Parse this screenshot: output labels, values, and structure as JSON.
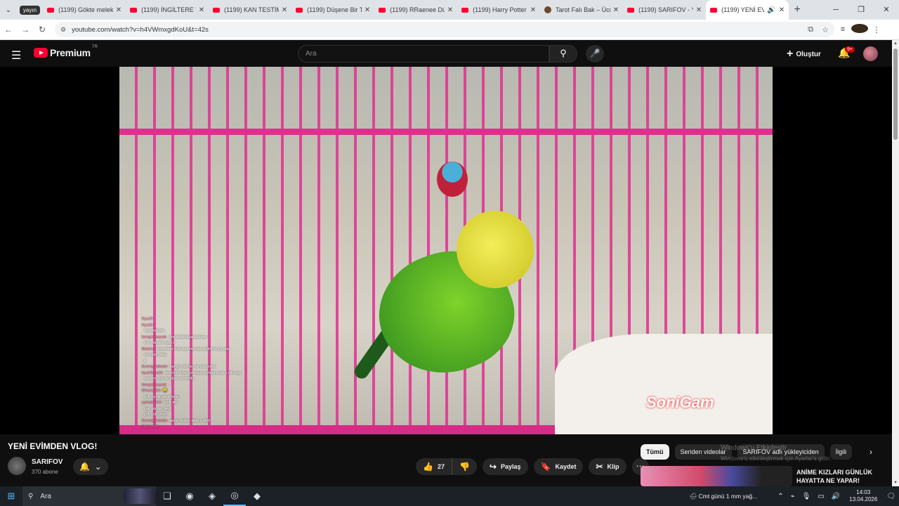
{
  "browser": {
    "group_label": "yayın",
    "tabs": [
      {
        "title": "(1199) Gökte melek",
        "favicon": "youtube-icon"
      },
      {
        "title": "(1199) İNGİLTERE VL",
        "favicon": "youtube-icon"
      },
      {
        "title": "(1199) KAN TESTİM",
        "favicon": "youtube-icon"
      },
      {
        "title": "(1199) Düşene Bir Te",
        "favicon": "youtube-icon"
      },
      {
        "title": "(1199) RRaenee Düş",
        "favicon": "youtube-icon"
      },
      {
        "title": "(1199) Harry Potter",
        "favicon": "youtube-icon"
      },
      {
        "title": "Tarot Falı Bak – Ücre",
        "favicon": "tarot-icon"
      },
      {
        "title": "(1199) SARIFOV - Yo",
        "favicon": "youtube-icon"
      },
      {
        "title": "(1199) YENİ EVİ",
        "favicon": "youtube-icon",
        "active": true
      }
    ],
    "url": "youtube.com/watch?v=h4VWmxgdKoU&t=42s"
  },
  "youtube": {
    "logo_text": "Premium",
    "region": "TR",
    "search_placeholder": "Ara",
    "create_label": "Oluştur",
    "notification_count": "9+"
  },
  "video": {
    "watermark": "SoniGam",
    "chat": [
      {
        "user": "Kyu10",
        "msg": ""
      },
      {
        "user": "Kyu10",
        "msg": ""
      },
      {
        "user": "",
        "msg": "hifjsdmfsdm"
      },
      {
        "user": "bengünbayrak",
        "msg": "sksdaldskdlsalkdalasd"
      },
      {
        "user": "",
        "msg": "tek yalçakli ugey.ir"
      },
      {
        "user": "Batuhx",
        "msg": "abonelere özel ses mesajı açilim fin ya abe"
      },
      {
        "user": "",
        "msg": "mesajım ekle"
      },
      {
        "user": "",
        "msg": "k"
      },
      {
        "user": "Ecemgunkeder",
        "msg": "bengin abi bu ne yakışıklık"
      },
      {
        "user": "kyu10kyu10",
        "msg": "abi rn50 fotsi için bazı sözlerim var x ollo cup"
      },
      {
        "user": "",
        "msg": "yazdım yok ve diyor ne mutlu"
      },
      {
        "user": "bengünbayrak",
        "msg": ":*"
      },
      {
        "user": "Ehsunjalim",
        "msg": "😄"
      },
      {
        "user": "",
        "msg": "yok ya ya gece falan"
      },
      {
        "user": "yamahar13",
        "msg": "iyidir abi"
      },
      {
        "user": "",
        "msg": "çok sia mu degil"
      },
      {
        "user": "",
        "msg": "yok çok iyisin"
      },
      {
        "user": "Ecemgunkeder",
        "msg": "anne cemre abla o bildi"
      },
      {
        "user": "NoXomuk",
        "msg": ""
      }
    ]
  },
  "watch": {
    "title": "YENİ EVİMDEN VLOG!",
    "channel": "SARIFOV",
    "subscribers": "370 abone",
    "likes": "27",
    "share_label": "Paylaş",
    "save_label": "Kaydet",
    "clip_label": "Klip",
    "chips": [
      "Tümü",
      "Seriden videolar",
      "SARIFOV adlı yükleyiciden",
      "İlgili"
    ],
    "windows_notice": "Windows'u Etkinleştir",
    "windows_notice_sub": "Windows'u etkinleştirmek için Ayarlar'a gidin.",
    "recommendation_title": "ANİME KIZLARI GÜNLÜK HAYATTA NE YAPAR!"
  },
  "taskbar": {
    "search_label": "Ara",
    "weather": "Cmt günü 1 mm yağ...",
    "time": "14:03",
    "date": "13.04.2026"
  }
}
